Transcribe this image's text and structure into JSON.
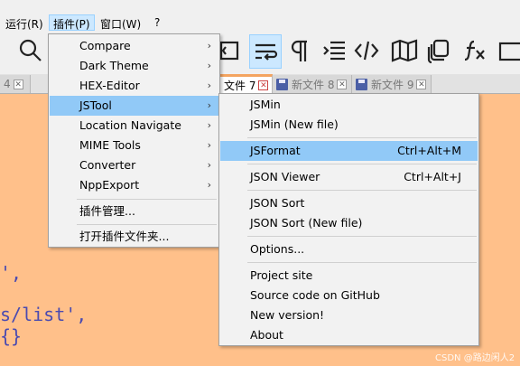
{
  "menubar": {
    "run": "运行(R)",
    "plugins": "插件(P)",
    "window": "窗口(W)",
    "help": "?"
  },
  "toolbar": {
    "icons": [
      "search-icon",
      "doc-map-icon",
      "word-wrap-icon",
      "show-all-chars-icon",
      "indent-guide-icon",
      "xml-tag-icon",
      "map-icon",
      "clipboard-history-icon",
      "function-list-icon",
      "folder-workspace-icon"
    ]
  },
  "tabs": [
    {
      "label": "4",
      "active": false
    },
    {
      "label": "文件 7",
      "active": true
    },
    {
      "label": "新文件 8",
      "active": false
    },
    {
      "label": "新文件 9",
      "active": false
    }
  ],
  "editor": {
    "line1": "',",
    "line2": "s/list',",
    "line3": "{}"
  },
  "plugins_menu": {
    "items": [
      {
        "label": "Compare",
        "submenu": true
      },
      {
        "label": "Dark Theme",
        "submenu": true
      },
      {
        "label": "HEX-Editor",
        "submenu": true
      },
      {
        "label": "JSTool",
        "submenu": true,
        "highlighted": true
      },
      {
        "label": "Location Navigate",
        "submenu": true
      },
      {
        "label": "MIME Tools",
        "submenu": true
      },
      {
        "label": "Converter",
        "submenu": true
      },
      {
        "label": "NppExport",
        "submenu": true
      },
      {
        "label": "插件管理...",
        "submenu": false
      },
      {
        "label": "打开插件文件夹...",
        "submenu": false
      }
    ],
    "arrow": "›"
  },
  "jstool_menu": {
    "items": [
      {
        "label": "JSMin",
        "shortcut": ""
      },
      {
        "label": "JSMin (New file)",
        "shortcut": ""
      },
      {
        "label": "JSFormat",
        "shortcut": "Ctrl+Alt+M",
        "highlighted": true
      },
      {
        "label": "JSON Viewer",
        "shortcut": "Ctrl+Alt+J"
      },
      {
        "label": "JSON Sort",
        "shortcut": ""
      },
      {
        "label": "JSON Sort (New file)",
        "shortcut": ""
      },
      {
        "label": "Options...",
        "shortcut": ""
      },
      {
        "label": "Project site",
        "shortcut": ""
      },
      {
        "label": "Source code on GitHub",
        "shortcut": ""
      },
      {
        "label": "New version!",
        "shortcut": ""
      },
      {
        "label": "About",
        "shortcut": ""
      }
    ]
  },
  "watermark": "CSDN @路边闲人2",
  "colors": {
    "editor_bg": "#FFC08A",
    "highlight": "#91C9F7",
    "menu_bg": "#F2F2F2",
    "code_text": "#4A4AB0"
  }
}
